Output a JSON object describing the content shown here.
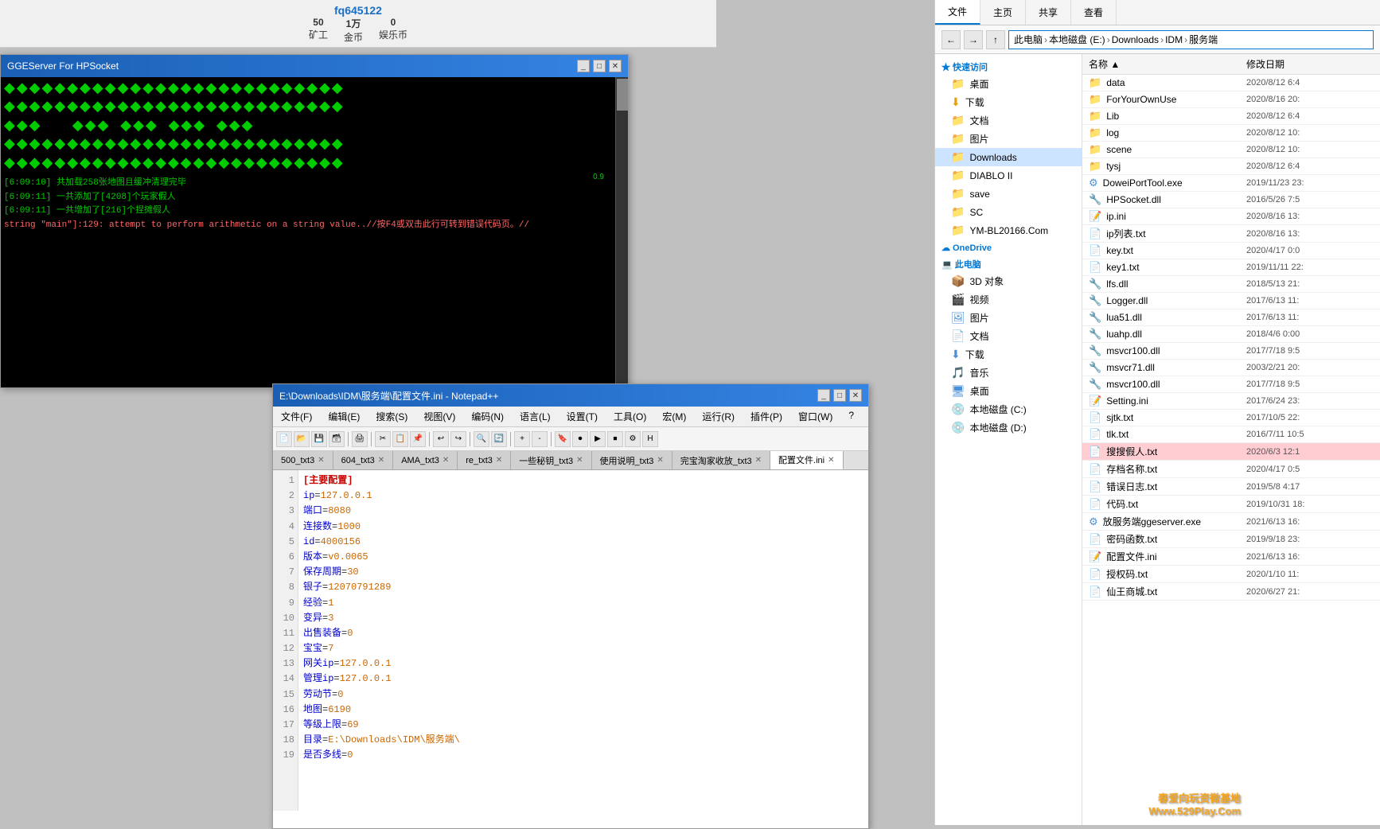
{
  "game": {
    "userId": "fq645122",
    "stats": [
      {
        "label": "矿工",
        "value": "50"
      },
      {
        "label": "金币",
        "value": "1万"
      },
      {
        "label": "娱乐币",
        "value": "0"
      }
    ]
  },
  "terminal": {
    "title": "GGEServer For HPSocket",
    "version": "0.9",
    "logs": [
      {
        "text": "[6:09:10]   共加载258张地图且缓冲清理完毕",
        "type": "normal"
      },
      {
        "text": "[6:09:11]   一共添加了[4208]个玩家假人",
        "type": "normal"
      },
      {
        "text": "[6:09:11]   一共增加了[216]个捏摊假人",
        "type": "normal"
      },
      {
        "text": "string \"main\"]:129: attempt to perform arithmetic on a string value..//按F4或双击此行可转到错误代码页。//",
        "type": "error"
      }
    ],
    "greenBlocks": "◆◆◆  ◆◆◆  ◆◆◆◆  ◆◆◆"
  },
  "notepad": {
    "title": "E:\\Downloads\\IDM\\服务端\\配置文件.ini - Notepad++",
    "menu": [
      "文件(F)",
      "编辑(E)",
      "搜索(S)",
      "视图(V)",
      "编码(N)",
      "语言(L)",
      "设置(T)",
      "工具(O)",
      "宏(M)",
      "运行(R)",
      "插件(P)",
      "窗口(W)",
      "?"
    ],
    "tabs": [
      {
        "label": "500_txt3",
        "active": false
      },
      {
        "label": "604_txt3",
        "active": false
      },
      {
        "label": "AMA_txt3",
        "active": false
      },
      {
        "label": "re_txt3",
        "active": false
      },
      {
        "label": "一些秘钥_txt3",
        "active": false
      },
      {
        "label": "使用说明_txt3",
        "active": false
      },
      {
        "label": "完宝淘家收放_txt3",
        "active": false
      },
      {
        "label": "配置文件.ini",
        "active": true
      }
    ],
    "lines": [
      1,
      2,
      3,
      4,
      5,
      6,
      7,
      8,
      9,
      10,
      11,
      12,
      13,
      14,
      15,
      16,
      17,
      18,
      19
    ],
    "code": [
      {
        "num": 1,
        "text": "【主要配置】",
        "type": "section"
      },
      {
        "num": 2,
        "text": "ip=127.0.0.1",
        "type": "keyval",
        "key": "ip",
        "val": "127.0.0.1"
      },
      {
        "num": 3,
        "text": "端口=8080",
        "type": "keyval",
        "key": "端口",
        "val": "8080"
      },
      {
        "num": 4,
        "text": "连接数=1000",
        "type": "keyval",
        "key": "连接数",
        "val": "1000"
      },
      {
        "num": 5,
        "text": "id=4000156",
        "type": "keyval",
        "key": "id",
        "val": "4000156"
      },
      {
        "num": 6,
        "text": "版本=v0.0065",
        "type": "keyval",
        "key": "版本",
        "val": "v0.0065"
      },
      {
        "num": 7,
        "text": "保存周期=30",
        "type": "keyval",
        "key": "保存周期",
        "val": "30"
      },
      {
        "num": 8,
        "text": "银子=12070791289",
        "type": "keyval",
        "key": "银子",
        "val": "12070791289"
      },
      {
        "num": 9,
        "text": "经验=1",
        "type": "keyval",
        "key": "经验",
        "val": "1"
      },
      {
        "num": 10,
        "text": "变异=3",
        "type": "keyval",
        "key": "变异",
        "val": "3"
      },
      {
        "num": 11,
        "text": "出售装备=0",
        "type": "keyval",
        "key": "出售装备",
        "val": "0"
      },
      {
        "num": 12,
        "text": "宝宝=7",
        "type": "keyval",
        "key": "宝宝",
        "val": "7"
      },
      {
        "num": 13,
        "text": "网关ip=127.0.0.1",
        "type": "keyval",
        "key": "网关ip",
        "val": "127.0.0.1"
      },
      {
        "num": 14,
        "text": "管理ip=127.0.0.1",
        "type": "keyval",
        "key": "管理ip",
        "val": "127.0.0.1"
      },
      {
        "num": 15,
        "text": "劳动节=0",
        "type": "keyval",
        "key": "劳动节",
        "val": "0"
      },
      {
        "num": 16,
        "text": "地图=6190",
        "type": "keyval",
        "key": "地图",
        "val": "6190"
      },
      {
        "num": 17,
        "text": "等级上限=69",
        "type": "keyval",
        "key": "等级上限",
        "val": "69"
      },
      {
        "num": 18,
        "text": "目录=E:\\Downloads\\IDM\\服务端\\",
        "type": "keyval",
        "key": "目录",
        "val": "E:\\Downloads\\IDM\\服务端\\"
      },
      {
        "num": 19,
        "text": "是否多线=0",
        "type": "keyval",
        "key": "是否多线",
        "val": "0"
      }
    ]
  },
  "explorer": {
    "ribbon_tabs": [
      "文件",
      "主页",
      "共享",
      "查看"
    ],
    "address": {
      "parts": [
        "此电脑",
        "本地磁盘 (E:)",
        "Downloads",
        "IDM",
        "服务端"
      ]
    },
    "sidebar": {
      "quickAccess": {
        "label": "快速访问",
        "items": [
          {
            "name": "桌面",
            "pinned": true
          },
          {
            "name": "下载",
            "pinned": true
          },
          {
            "name": "文档",
            "pinned": true
          },
          {
            "name": "图片",
            "pinned": true
          },
          {
            "name": "Downloads",
            "pinned": true
          },
          {
            "name": "DIABLO II"
          },
          {
            "name": "save"
          },
          {
            "name": "SC"
          },
          {
            "name": "YM-BL20166.Com"
          }
        ]
      },
      "oneDrive": {
        "label": "OneDrive"
      },
      "thisPC": {
        "label": "此电脑",
        "items": [
          {
            "name": "3D 对象"
          },
          {
            "name": "视频"
          },
          {
            "name": "图片"
          },
          {
            "name": "文档"
          },
          {
            "name": "下载"
          },
          {
            "name": "音乐"
          },
          {
            "name": "桌面"
          },
          {
            "name": "本地磁盘 (C:)"
          },
          {
            "name": "本地磁盘 (D:)"
          }
        ]
      }
    },
    "columns": {
      "name": "名称",
      "date": "修改日期"
    },
    "files": [
      {
        "name": "data",
        "type": "folder",
        "date": "2020/8/12 6:4"
      },
      {
        "name": "ForYourOwnUse",
        "type": "folder",
        "date": "2020/8/16 20:"
      },
      {
        "name": "Lib",
        "type": "folder",
        "date": "2020/8/12 6:4"
      },
      {
        "name": "log",
        "type": "folder",
        "date": "2020/8/12 10:"
      },
      {
        "name": "scene",
        "type": "folder",
        "date": "2020/8/12 10:"
      },
      {
        "name": "tysj",
        "type": "folder",
        "date": "2020/8/12 6:4"
      },
      {
        "name": "DoweiPortTool.exe",
        "type": "exe",
        "date": "2019/11/23 23:"
      },
      {
        "name": "HPSocket.dll",
        "type": "dll",
        "date": "2016/5/26 7:5"
      },
      {
        "name": "ip.ini",
        "type": "ini",
        "date": "2020/8/16 13:"
      },
      {
        "name": "ip列表.txt",
        "type": "txt",
        "date": "2020/8/16 13:"
      },
      {
        "name": "key.txt",
        "type": "txt",
        "date": "2020/4/17 0:0"
      },
      {
        "name": "key1.txt",
        "type": "txt",
        "date": "2019/11/11 22:"
      },
      {
        "name": "lfs.dll",
        "type": "dll",
        "date": "2018/5/13 21:"
      },
      {
        "name": "Logger.dll",
        "type": "dll",
        "date": "2017/6/13 11:"
      },
      {
        "name": "lua51.dll",
        "type": "dll",
        "date": "2017/6/13 11:"
      },
      {
        "name": "luahp.dll",
        "type": "dll",
        "date": "2018/4/6 0:00"
      },
      {
        "name": "msvcr100.dll",
        "type": "dll",
        "date": "2017/7/18 9:5"
      },
      {
        "name": "msvcr71.dll",
        "type": "dll",
        "date": "2003/2/21 20:"
      },
      {
        "name": "msvcr100.dll",
        "type": "dll",
        "date": "2017/7/18 9:5"
      },
      {
        "name": "Setting.ini",
        "type": "ini",
        "date": "2017/6/24 23:"
      },
      {
        "name": "sjtk.txt",
        "type": "txt",
        "date": "2017/10/5 22:"
      },
      {
        "name": "tlk.txt",
        "type": "txt",
        "date": "2016/7/11 10:5"
      },
      {
        "name": "搜搜假人.txt",
        "type": "txt",
        "date": "2020/6/3 12:1",
        "selected": true
      },
      {
        "name": "存档名称.txt",
        "type": "txt",
        "date": "2020/4/17 0:5"
      },
      {
        "name": "错误日志.txt",
        "type": "txt",
        "date": "2019/5/8 4:17"
      },
      {
        "name": "代码.txt",
        "type": "txt",
        "date": "2019/10/31 18:"
      },
      {
        "name": "放服务端ggeserver.exe",
        "type": "exe",
        "date": "2021/6/13 16:"
      },
      {
        "name": "密码函数.txt",
        "type": "txt",
        "date": "2019/9/18 23:"
      },
      {
        "name": "配置文件.ini",
        "type": "ini",
        "date": "2021/6/13 16:"
      },
      {
        "name": "授权码.txt",
        "type": "txt",
        "date": "2020/1/10 11:"
      },
      {
        "name": "仙王商城.txt",
        "type": "txt",
        "date": "2020/6/27 21:"
      }
    ]
  },
  "watermark": {
    "line1": "春爱向玩资微基地",
    "line2": "Www.529Play.Com"
  }
}
